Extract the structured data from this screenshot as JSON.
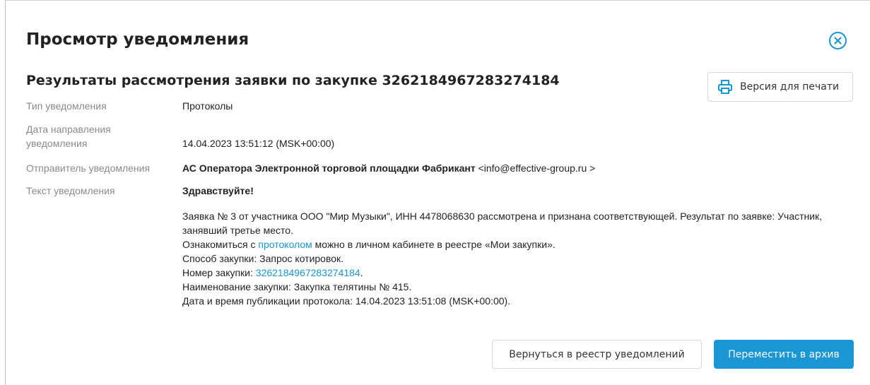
{
  "dialog": {
    "title": "Просмотр уведомления",
    "subtitle": "Результаты рассмотрения заявки по закупке 3262184967283274184",
    "print_label": "Версия для печати",
    "accent_color": "#1a96d4"
  },
  "fields": {
    "type": {
      "label": "Тип уведомления",
      "value": "Протоколы"
    },
    "date": {
      "label_line1": "Дата направления",
      "label_line2": "уведомления",
      "value": "14.04.2023 13:51:12 (MSK+00:00)"
    },
    "sender": {
      "label": "Отправитель уведомления",
      "name": "АС Оператора Электронной торговой площадки Фабрикант",
      "email": " <info@effective-group.ru >"
    },
    "text": {
      "label": "Текст уведомления",
      "greeting": "Здравствуйте!"
    }
  },
  "message": {
    "line1": "Заявка № 3 от участника ООО \"Мир Музыки\", ИНН 4478068630 рассмотрена и признана соответствующей. Результат по заявке: Участник, занявший третье место.",
    "line2_pre": "Ознакомиться с ",
    "line2_link": "протоколом",
    "line2_post": " можно в личном кабинете в реестре «Мои закупки».",
    "line3": "Способ закупки: Запрос котировок.",
    "line4_pre": "Номер закупки: ",
    "line4_link": "3262184967283274184",
    "line4_post": ".",
    "line5": "Наименование закупки: Закупка телятины № 415.",
    "line6": "Дата и время публикации протокола: 14.04.2023 13:51:08 (MSK+00:00)."
  },
  "actions": {
    "back_label": "Вернуться в реестр уведомлений",
    "archive_label": "Переместить в архив"
  },
  "icons": {
    "close": "close-circle-icon",
    "print": "printer-icon"
  }
}
